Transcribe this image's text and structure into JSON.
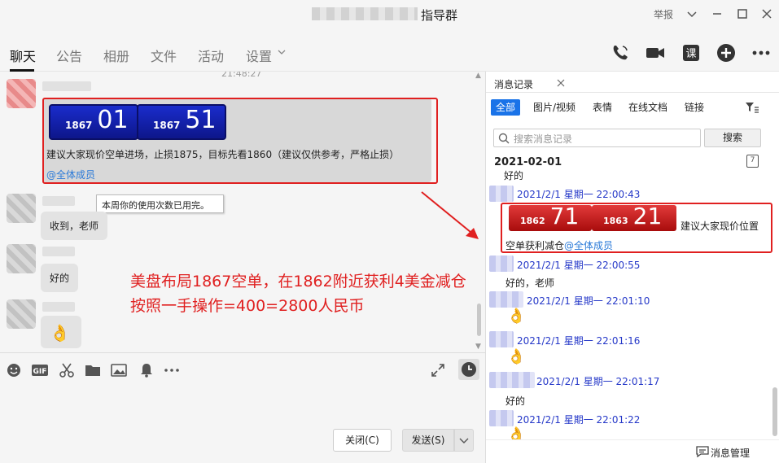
{
  "window": {
    "title": "指导群",
    "report_label": "举报"
  },
  "nav": {
    "tabs": [
      "聊天",
      "公告",
      "相册",
      "文件",
      "活动",
      "设置"
    ]
  },
  "chat": {
    "top_time": "21:48:27",
    "card1": {
      "left_small": "1867",
      "left_big": "01",
      "right_small": "1867",
      "right_big": "51"
    },
    "advice_text": "建议大家现价空单进场，止损1875，目标先看1860（建议仅供参考，严格止损）",
    "mention": "@全体成员",
    "tooltip": "本周你的使用次数已用完。",
    "reply1": "收到，老师",
    "reply2": "好的",
    "annotation_line1": "美盘布局1867空单，在1862附近获利4美金减仓",
    "annotation_line2": "按照一手操作=400=2800人民币"
  },
  "input": {
    "close_label": "关闭(C)",
    "send_label": "发送(S)"
  },
  "history": {
    "tab_label": "消息记录",
    "filters": [
      "全部",
      "图片/视频",
      "表情",
      "在线文档",
      "链接"
    ],
    "search_placeholder": "搜索消息记录",
    "search_button": "搜索",
    "date": "2021-02-01",
    "cal_day": "7",
    "partial_top": "好的",
    "ts1": "2021/2/1 星期一 22:00:43",
    "card2": {
      "left_small": "1862",
      "left_big": "71",
      "right_small": "1863",
      "right_big": "21"
    },
    "card2_text_a": "建议大家现价位置",
    "card2_text_b": "空单获利减仓",
    "card2_mention": "@全体成员",
    "ts2": "2021/2/1 星期一 22:00:55",
    "msg2": "好的，老师",
    "ts3": "2021/2/1 星期一 22:01:10",
    "ts4": "2021/2/1 星期一 22:01:16",
    "ts5": "2021/2/1 星期一 22:01:17",
    "msg5": "好的",
    "ts6": "2021/2/1 星期一 22:01:22",
    "manage_label": "消息管理"
  },
  "colors": {
    "accent": "#1a73e8",
    "highlight_red": "#e02020",
    "timestamp_blue": "#2538c8",
    "card_blue": "#1a2ccc",
    "card_red": "#e23a3a"
  }
}
